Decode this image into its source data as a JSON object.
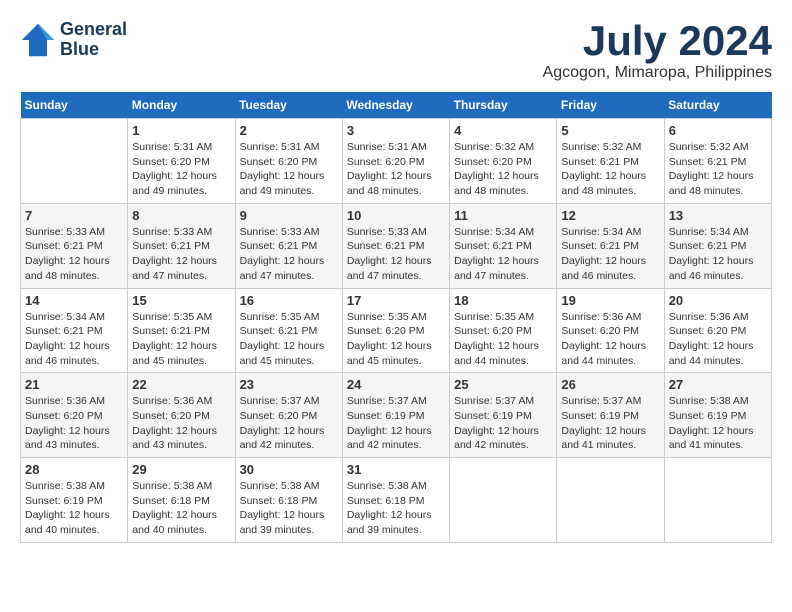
{
  "header": {
    "logo_line1": "General",
    "logo_line2": "Blue",
    "month_title": "July 2024",
    "location": "Agcogon, Mimaropa, Philippines"
  },
  "calendar": {
    "days_of_week": [
      "Sunday",
      "Monday",
      "Tuesday",
      "Wednesday",
      "Thursday",
      "Friday",
      "Saturday"
    ],
    "weeks": [
      [
        {
          "day": "",
          "info": ""
        },
        {
          "day": "1",
          "info": "Sunrise: 5:31 AM\nSunset: 6:20 PM\nDaylight: 12 hours and 49 minutes."
        },
        {
          "day": "2",
          "info": "Sunrise: 5:31 AM\nSunset: 6:20 PM\nDaylight: 12 hours and 49 minutes."
        },
        {
          "day": "3",
          "info": "Sunrise: 5:31 AM\nSunset: 6:20 PM\nDaylight: 12 hours and 48 minutes."
        },
        {
          "day": "4",
          "info": "Sunrise: 5:32 AM\nSunset: 6:20 PM\nDaylight: 12 hours and 48 minutes."
        },
        {
          "day": "5",
          "info": "Sunrise: 5:32 AM\nSunset: 6:21 PM\nDaylight: 12 hours and 48 minutes."
        },
        {
          "day": "6",
          "info": "Sunrise: 5:32 AM\nSunset: 6:21 PM\nDaylight: 12 hours and 48 minutes."
        }
      ],
      [
        {
          "day": "7",
          "info": "Sunrise: 5:33 AM\nSunset: 6:21 PM\nDaylight: 12 hours and 48 minutes."
        },
        {
          "day": "8",
          "info": "Sunrise: 5:33 AM\nSunset: 6:21 PM\nDaylight: 12 hours and 47 minutes."
        },
        {
          "day": "9",
          "info": "Sunrise: 5:33 AM\nSunset: 6:21 PM\nDaylight: 12 hours and 47 minutes."
        },
        {
          "day": "10",
          "info": "Sunrise: 5:33 AM\nSunset: 6:21 PM\nDaylight: 12 hours and 47 minutes."
        },
        {
          "day": "11",
          "info": "Sunrise: 5:34 AM\nSunset: 6:21 PM\nDaylight: 12 hours and 47 minutes."
        },
        {
          "day": "12",
          "info": "Sunrise: 5:34 AM\nSunset: 6:21 PM\nDaylight: 12 hours and 46 minutes."
        },
        {
          "day": "13",
          "info": "Sunrise: 5:34 AM\nSunset: 6:21 PM\nDaylight: 12 hours and 46 minutes."
        }
      ],
      [
        {
          "day": "14",
          "info": "Sunrise: 5:34 AM\nSunset: 6:21 PM\nDaylight: 12 hours and 46 minutes."
        },
        {
          "day": "15",
          "info": "Sunrise: 5:35 AM\nSunset: 6:21 PM\nDaylight: 12 hours and 45 minutes."
        },
        {
          "day": "16",
          "info": "Sunrise: 5:35 AM\nSunset: 6:21 PM\nDaylight: 12 hours and 45 minutes."
        },
        {
          "day": "17",
          "info": "Sunrise: 5:35 AM\nSunset: 6:20 PM\nDaylight: 12 hours and 45 minutes."
        },
        {
          "day": "18",
          "info": "Sunrise: 5:35 AM\nSunset: 6:20 PM\nDaylight: 12 hours and 44 minutes."
        },
        {
          "day": "19",
          "info": "Sunrise: 5:36 AM\nSunset: 6:20 PM\nDaylight: 12 hours and 44 minutes."
        },
        {
          "day": "20",
          "info": "Sunrise: 5:36 AM\nSunset: 6:20 PM\nDaylight: 12 hours and 44 minutes."
        }
      ],
      [
        {
          "day": "21",
          "info": "Sunrise: 5:36 AM\nSunset: 6:20 PM\nDaylight: 12 hours and 43 minutes."
        },
        {
          "day": "22",
          "info": "Sunrise: 5:36 AM\nSunset: 6:20 PM\nDaylight: 12 hours and 43 minutes."
        },
        {
          "day": "23",
          "info": "Sunrise: 5:37 AM\nSunset: 6:20 PM\nDaylight: 12 hours and 42 minutes."
        },
        {
          "day": "24",
          "info": "Sunrise: 5:37 AM\nSunset: 6:19 PM\nDaylight: 12 hours and 42 minutes."
        },
        {
          "day": "25",
          "info": "Sunrise: 5:37 AM\nSunset: 6:19 PM\nDaylight: 12 hours and 42 minutes."
        },
        {
          "day": "26",
          "info": "Sunrise: 5:37 AM\nSunset: 6:19 PM\nDaylight: 12 hours and 41 minutes."
        },
        {
          "day": "27",
          "info": "Sunrise: 5:38 AM\nSunset: 6:19 PM\nDaylight: 12 hours and 41 minutes."
        }
      ],
      [
        {
          "day": "28",
          "info": "Sunrise: 5:38 AM\nSunset: 6:19 PM\nDaylight: 12 hours and 40 minutes."
        },
        {
          "day": "29",
          "info": "Sunrise: 5:38 AM\nSunset: 6:18 PM\nDaylight: 12 hours and 40 minutes."
        },
        {
          "day": "30",
          "info": "Sunrise: 5:38 AM\nSunset: 6:18 PM\nDaylight: 12 hours and 39 minutes."
        },
        {
          "day": "31",
          "info": "Sunrise: 5:38 AM\nSunset: 6:18 PM\nDaylight: 12 hours and 39 minutes."
        },
        {
          "day": "",
          "info": ""
        },
        {
          "day": "",
          "info": ""
        },
        {
          "day": "",
          "info": ""
        }
      ]
    ]
  }
}
